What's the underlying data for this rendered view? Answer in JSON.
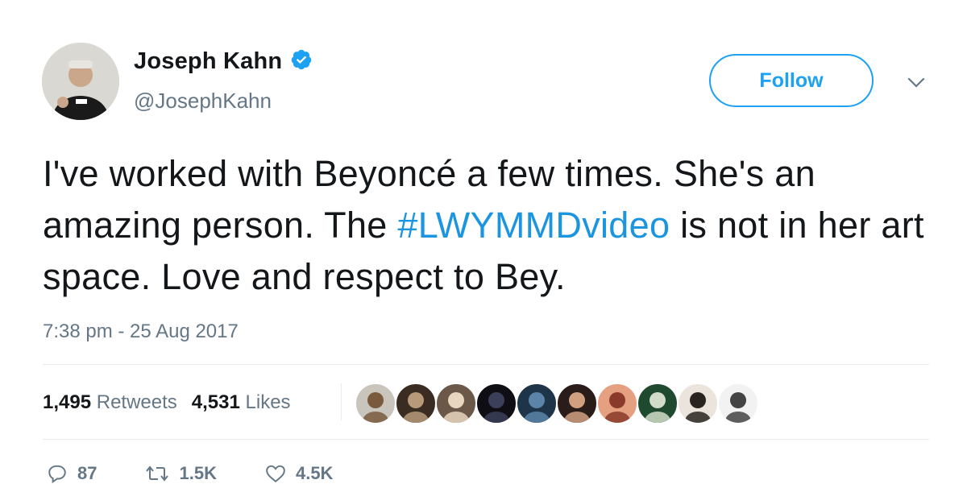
{
  "author": {
    "name": "Joseph Kahn",
    "handle": "@JosephKahn",
    "verified": true,
    "avatar_icon": "profile-photo"
  },
  "follow_button": {
    "label": "Follow"
  },
  "menu": {
    "icon": "chevron-down-icon"
  },
  "tweet": {
    "text_before": "I've worked with Beyoncé a few times. She's an amazing person. The ",
    "hashtag": "#LWYMMDvideo",
    "text_after": " is not in her art space. Love and respect to Bey.",
    "timestamp": "7:38 pm - 25 Aug 2017"
  },
  "stats": {
    "retweets_count": "1,495",
    "retweets_label": "Retweets",
    "likes_count": "4,531",
    "likes_label": "Likes"
  },
  "liker_avatars": [
    {
      "bg": "#c9c4bc",
      "fg": "#7a5a3c"
    },
    {
      "bg": "#3a2c22",
      "fg": "#b89a7a"
    },
    {
      "bg": "#6b5848",
      "fg": "#e8d6c0"
    },
    {
      "bg": "#0e0e14",
      "fg": "#3b3f59"
    },
    {
      "bg": "#1e3448",
      "fg": "#5b84a8"
    },
    {
      "bg": "#2a1c18",
      "fg": "#d0a080"
    },
    {
      "bg": "#e4a080",
      "fg": "#8a3a2a"
    },
    {
      "bg": "#1f4a30",
      "fg": "#d2dcc8"
    },
    {
      "bg": "#ebe4dc",
      "fg": "#2a2420"
    },
    {
      "bg": "#f2f2f2",
      "fg": "#444444"
    }
  ],
  "actions": {
    "reply_count": "87",
    "retweet_count": "1.5K",
    "like_count": "4.5K"
  },
  "colors": {
    "accent": "#1da1f2",
    "hashtag": "#1b95e0",
    "muted": "#657786",
    "text": "#14171a"
  }
}
